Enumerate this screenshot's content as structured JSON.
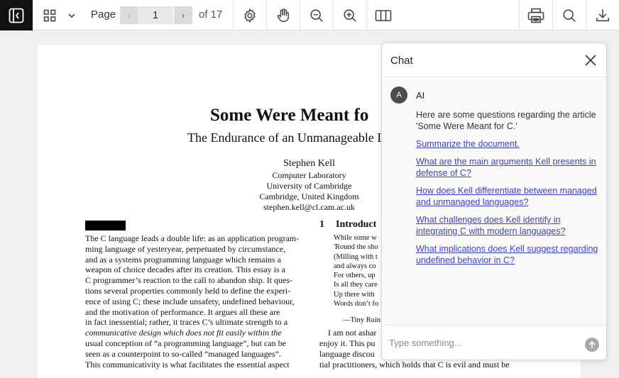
{
  "toolbar": {
    "page_label": "Page",
    "current_page": "1",
    "page_count_label": "of 17",
    "prev_arrow": "‹",
    "next_arrow": "›"
  },
  "document": {
    "title": "Some Were Meant fo",
    "subtitle": "The Endurance of an Unmanageable L",
    "author": "Stephen Kell",
    "affiliation": [
      "Computer Laboratory",
      "University of Cambridge",
      "Cambridge, United Kingdom",
      "stephen.kell@cl.cam.ac.uk"
    ],
    "abstract_lines": [
      "The C language leads a double life: as an application program-",
      "ming language of yesteryear, perpetuated by circumstance,",
      "and as a systems programming language which remains a",
      "weapon of choice decades after its creation. This essay is a",
      "C programmer’s reaction to the call to abandon ship. It ques-",
      "tions several properties commonly held to define the experi-",
      "ence of using C; these include unsafety, undefined behaviour,",
      "and the motivation of performance. It argues all these are",
      "in fact inessential; rather, it traces C’s ultimate strength to a",
      "communicative design which does not fit easily within the",
      "usual conception of “a programming language”, but can be",
      "seen as a counterpoint to so-called “managed languages”.",
      "This communicativity is what facilitates the essential aspect"
    ],
    "section_number": "1",
    "section_title": "Introduct",
    "poem_lines": [
      "While some w",
      "'Round the sho",
      "(Milling with t",
      "and always co",
      "For others, up",
      "Is all they care",
      "Up there with",
      "Words don’t fo"
    ],
    "poem_attribution": "—Tiny Ruin",
    "body_lines": [
      "I am not ashar",
      "enjoy it. This pu",
      "language discou",
      "tial practitioners, which holds that C is evil and must be"
    ]
  },
  "chat": {
    "title": "Chat",
    "avatar_initial": "A",
    "sender": "AI",
    "intro": "Here are some questions regarding the article 'Some Were Meant for C.'",
    "questions": [
      "Summarize the document.",
      "What are the main arguments Kell presents in defense of C?",
      "How does Kell differentiate between managed and unmanaged languages?",
      "What challenges does Kell identify in integrating C with modern languages?",
      "What implications does Kell suggest regarding undefined behavior in C?"
    ],
    "input_placeholder": "Type something..."
  },
  "colors": {
    "sidebar_toggle_bg": "#111111",
    "link": "#3b3fd6",
    "avatar_bg": "#4a4d55"
  }
}
